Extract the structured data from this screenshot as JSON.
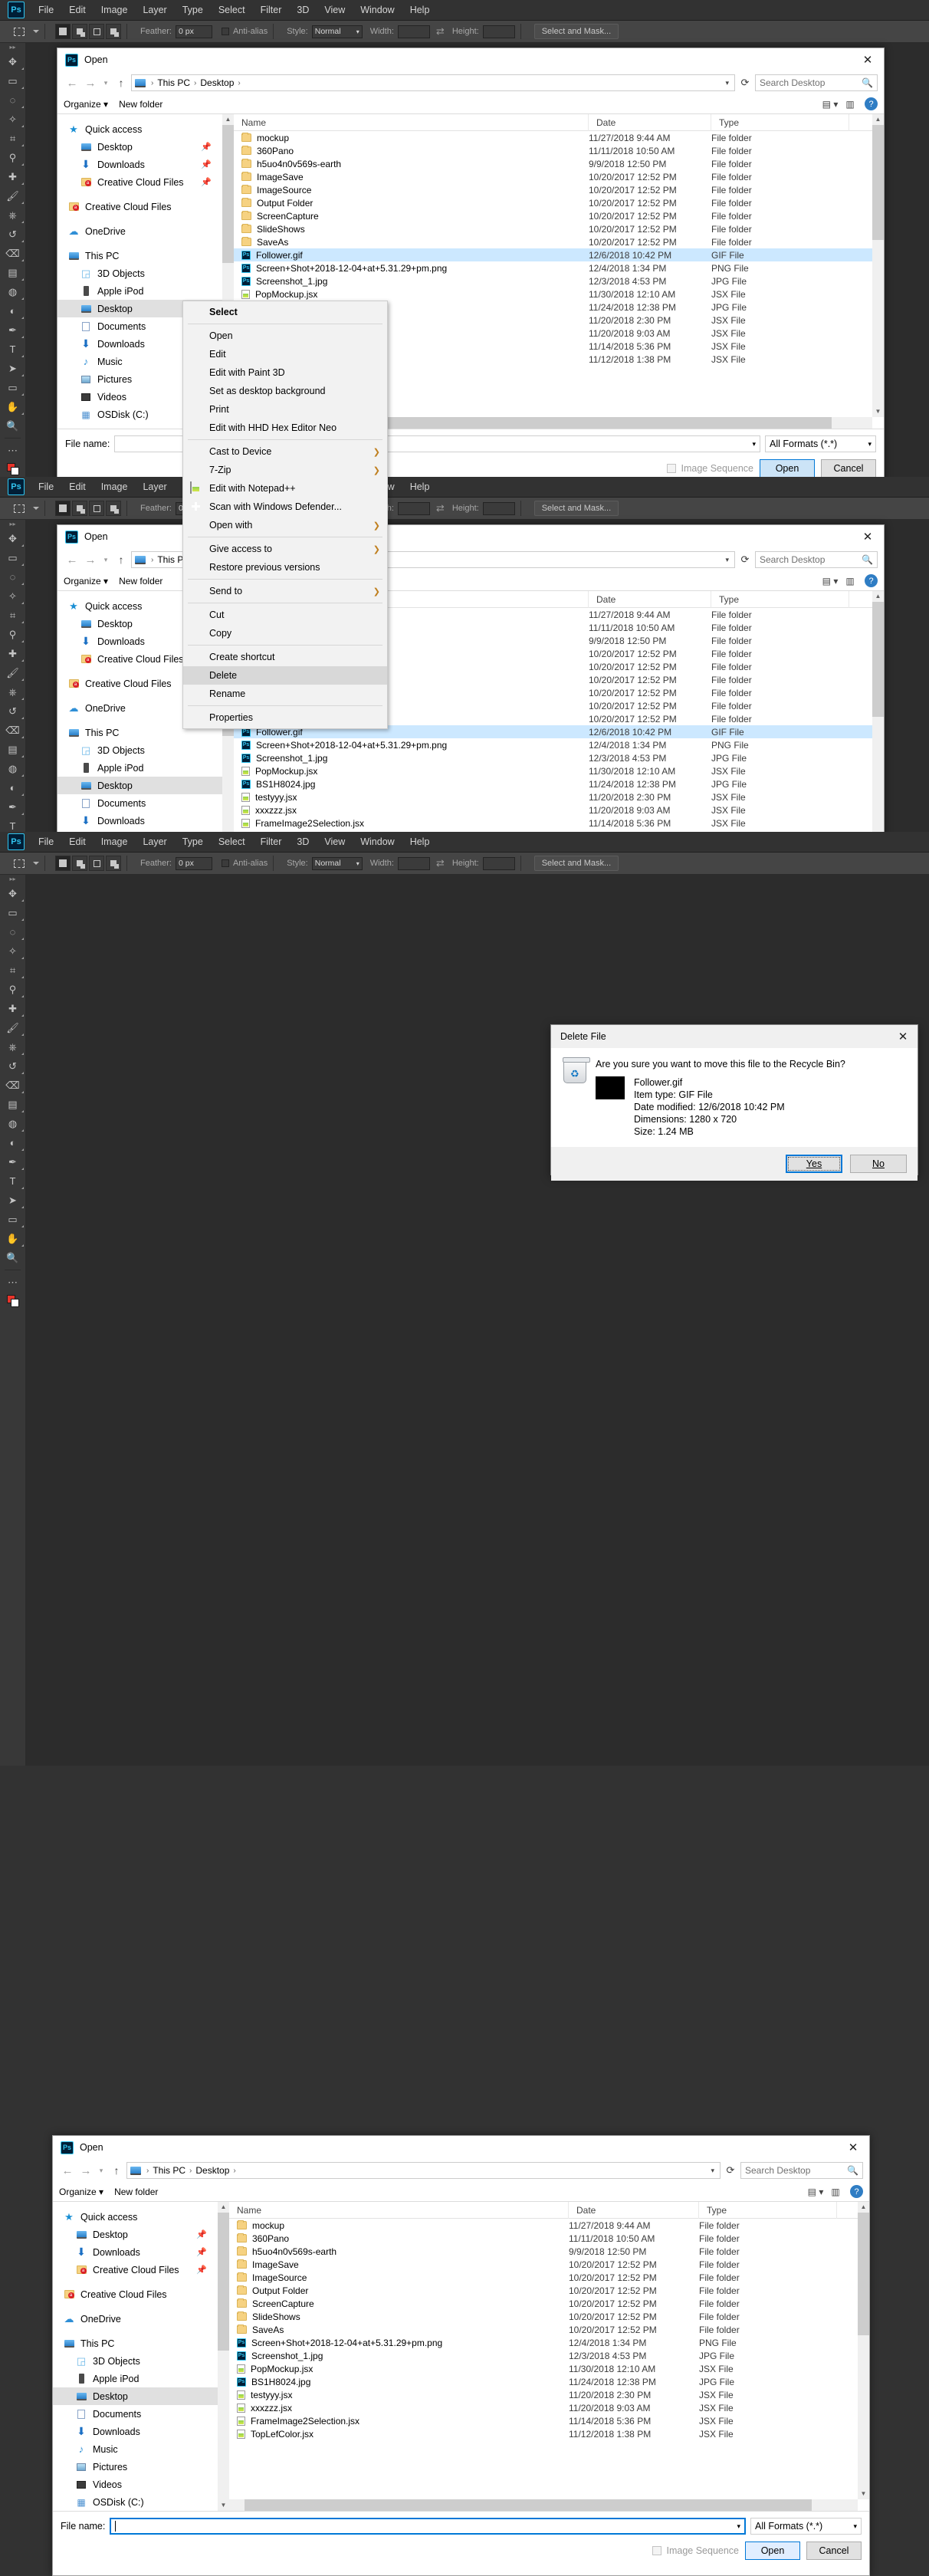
{
  "photoshop": {
    "logo": "Ps",
    "menu": [
      "File",
      "Edit",
      "Image",
      "Layer",
      "Type",
      "Select",
      "Filter",
      "3D",
      "View",
      "Window",
      "Help"
    ],
    "options": {
      "feather_label": "Feather:",
      "feather_value": "0 px",
      "antialias_label": "Anti-alias",
      "style_label": "Style:",
      "style_value": "Normal",
      "width_label": "Width:",
      "width_value": "",
      "height_label": "Height:",
      "height_value": "",
      "select_mask_label": "Select and Mask..."
    }
  },
  "dialog": {
    "title": "Open",
    "logo": "Ps",
    "breadcrumb": [
      "This PC",
      "Desktop",
      ""
    ],
    "search_placeholder": "Search Desktop",
    "organize_label": "Organize",
    "new_folder_label": "New folder",
    "help_label": "?",
    "columns": [
      "Name",
      "Date",
      "Type"
    ],
    "navpane": [
      {
        "label": "Quick access",
        "icon": "star-icon",
        "indent": 0,
        "pin": false,
        "state": "none"
      },
      {
        "label": "Desktop",
        "icon": "monitor-icon",
        "indent": 1,
        "pin": true,
        "state": "none"
      },
      {
        "label": "Downloads",
        "icon": "download-icon",
        "indent": 1,
        "pin": true,
        "state": "none"
      },
      {
        "label": "Creative Cloud Files",
        "icon": "cc-folder-icon",
        "indent": 1,
        "pin": true,
        "state": "none"
      },
      {
        "label": "Creative Cloud Files",
        "icon": "cc-folder-icon",
        "indent": 0,
        "pin": false,
        "state": "gap"
      },
      {
        "label": "OneDrive",
        "icon": "cloud-icon",
        "indent": 0,
        "pin": false,
        "state": "gap"
      },
      {
        "label": "This PC",
        "icon": "monitor-icon",
        "indent": 0,
        "pin": false,
        "state": "gap"
      },
      {
        "label": "3D Objects",
        "icon": "cube-icon",
        "indent": 1,
        "pin": false,
        "state": "none"
      },
      {
        "label": "Apple iPod",
        "icon": "ipod-icon",
        "indent": 1,
        "pin": false,
        "state": "none"
      },
      {
        "label": "Desktop",
        "icon": "monitor-icon",
        "indent": 1,
        "pin": false,
        "state": "selected"
      },
      {
        "label": "Documents",
        "icon": "document-icon",
        "indent": 1,
        "pin": false,
        "state": "none"
      },
      {
        "label": "Downloads",
        "icon": "download-icon",
        "indent": 1,
        "pin": false,
        "state": "none"
      },
      {
        "label": "Music",
        "icon": "music-icon",
        "indent": 1,
        "pin": false,
        "state": "none"
      },
      {
        "label": "Pictures",
        "icon": "picture-icon",
        "indent": 1,
        "pin": false,
        "state": "none"
      },
      {
        "label": "Videos",
        "icon": "video-icon",
        "indent": 1,
        "pin": false,
        "state": "none"
      },
      {
        "label": "OSDisk (C:)",
        "icon": "disk-icon",
        "indent": 1,
        "pin": false,
        "state": "none"
      }
    ],
    "files": [
      {
        "name": "mockup",
        "date": "11/27/2018 9:44 AM",
        "type": "File folder",
        "icon": "folder-icon"
      },
      {
        "name": "360Pano",
        "date": "11/11/2018 10:50 AM",
        "type": "File folder",
        "icon": "folder-icon"
      },
      {
        "name": "h5uo4n0v569s-earth",
        "date": "9/9/2018 12:50 PM",
        "type": "File folder",
        "icon": "folder-icon"
      },
      {
        "name": "ImageSave",
        "date": "10/20/2017 12:52 PM",
        "type": "File folder",
        "icon": "folder-icon"
      },
      {
        "name": "ImageSource",
        "date": "10/20/2017 12:52 PM",
        "type": "File folder",
        "icon": "folder-icon"
      },
      {
        "name": "Output Folder",
        "date": "10/20/2017 12:52 PM",
        "type": "File folder",
        "icon": "folder-icon"
      },
      {
        "name": "ScreenCapture",
        "date": "10/20/2017 12:52 PM",
        "type": "File folder",
        "icon": "folder-icon"
      },
      {
        "name": "SlideShows",
        "date": "10/20/2017 12:52 PM",
        "type": "File folder",
        "icon": "folder-icon"
      },
      {
        "name": "SaveAs",
        "date": "10/20/2017 12:52 PM",
        "type": "File folder",
        "icon": "folder-icon"
      },
      {
        "name": "Follower.gif",
        "date": "12/6/2018 10:42 PM",
        "type": "GIF File",
        "icon": "ps-file-icon"
      },
      {
        "name": "Screen+Shot+2018-12-04+at+5.31.29+pm.png",
        "date": "12/4/2018 1:34 PM",
        "type": "PNG File",
        "icon": "ps-file-icon"
      },
      {
        "name": "Screenshot_1.jpg",
        "date": "12/3/2018 4:53 PM",
        "type": "JPG File",
        "icon": "ps-file-icon"
      },
      {
        "name": "PopMockup.jsx",
        "date": "11/30/2018 12:10 AM",
        "type": "JSX File",
        "icon": "jsx-file-icon"
      },
      {
        "name": "BS1H8024.jpg",
        "date": "11/24/2018 12:38 PM",
        "type": "JPG File",
        "icon": "ps-file-icon"
      },
      {
        "name": "testyyy.jsx",
        "date": "11/20/2018 2:30 PM",
        "type": "JSX File",
        "icon": "jsx-file-icon"
      },
      {
        "name": "xxxzzz.jsx",
        "date": "11/20/2018 9:03 AM",
        "type": "JSX File",
        "icon": "jsx-file-icon"
      },
      {
        "name": "FrameImage2Selection.jsx",
        "date": "11/14/2018 5:36 PM",
        "type": "JSX File",
        "icon": "jsx-file-icon"
      },
      {
        "name": "TopLefColor.jsx",
        "date": "11/12/2018 1:38 PM",
        "type": "JSX File",
        "icon": "jsx-file-icon"
      }
    ],
    "filename_label": "File name:",
    "filename_empty": "",
    "filename_follower": "Follower.gif",
    "format_value": "All Formats (*.*)",
    "image_sequence_label": "Image Sequence",
    "open_label": "Open",
    "cancel_label": "Cancel"
  },
  "context_menu": [
    {
      "label": "Select",
      "bold": true,
      "arrow": false,
      "icon": null,
      "sep_after": true
    },
    {
      "label": "Open",
      "bold": false,
      "arrow": false,
      "icon": null
    },
    {
      "label": "Edit",
      "bold": false,
      "arrow": false,
      "icon": null
    },
    {
      "label": "Edit with Paint 3D",
      "bold": false,
      "arrow": false,
      "icon": null
    },
    {
      "label": "Set as desktop background",
      "bold": false,
      "arrow": false,
      "icon": null
    },
    {
      "label": "Print",
      "bold": false,
      "arrow": false,
      "icon": null
    },
    {
      "label": "Edit with HHD Hex Editor Neo",
      "bold": false,
      "arrow": false,
      "icon": null,
      "sep_after": true
    },
    {
      "label": "Cast to Device",
      "bold": false,
      "arrow": true,
      "icon": null
    },
    {
      "label": "7-Zip",
      "bold": false,
      "arrow": true,
      "icon": null
    },
    {
      "label": "Edit with Notepad++",
      "bold": false,
      "arrow": false,
      "icon": "notepadpp-icon"
    },
    {
      "label": "Scan with Windows Defender...",
      "bold": false,
      "arrow": false,
      "icon": "defender-icon"
    },
    {
      "label": "Open with",
      "bold": false,
      "arrow": true,
      "icon": null,
      "sep_after": true
    },
    {
      "label": "Give access to",
      "bold": false,
      "arrow": true,
      "icon": null
    },
    {
      "label": "Restore previous versions",
      "bold": false,
      "arrow": false,
      "icon": null,
      "sep_after": true
    },
    {
      "label": "Send to",
      "bold": false,
      "arrow": true,
      "icon": null,
      "sep_after": true
    },
    {
      "label": "Cut",
      "bold": false,
      "arrow": false,
      "icon": null
    },
    {
      "label": "Copy",
      "bold": false,
      "arrow": false,
      "icon": null,
      "sep_after": true
    },
    {
      "label": "Create shortcut",
      "bold": false,
      "arrow": false,
      "icon": null
    },
    {
      "label": "Delete",
      "bold": false,
      "arrow": false,
      "icon": null,
      "highlight": true
    },
    {
      "label": "Rename",
      "bold": false,
      "arrow": false,
      "icon": null,
      "sep_after": true
    },
    {
      "label": "Properties",
      "bold": false,
      "arrow": false,
      "icon": null
    }
  ],
  "delete_dialog": {
    "title": "Delete File",
    "question": "Are you sure you want to move this file to the Recycle Bin?",
    "file_name": "Follower.gif",
    "item_type": "Item type: GIF File",
    "date_modified": "Date modified: 12/6/2018 10:42 PM",
    "dimensions": "Dimensions: 1280 x 720",
    "size": "Size: 1.24 MB",
    "yes_label": "Yes",
    "no_label": "No"
  },
  "colors": {
    "accent": "#0078d7",
    "ps_blue": "#31c5f0",
    "selection": "#cce8ff"
  }
}
